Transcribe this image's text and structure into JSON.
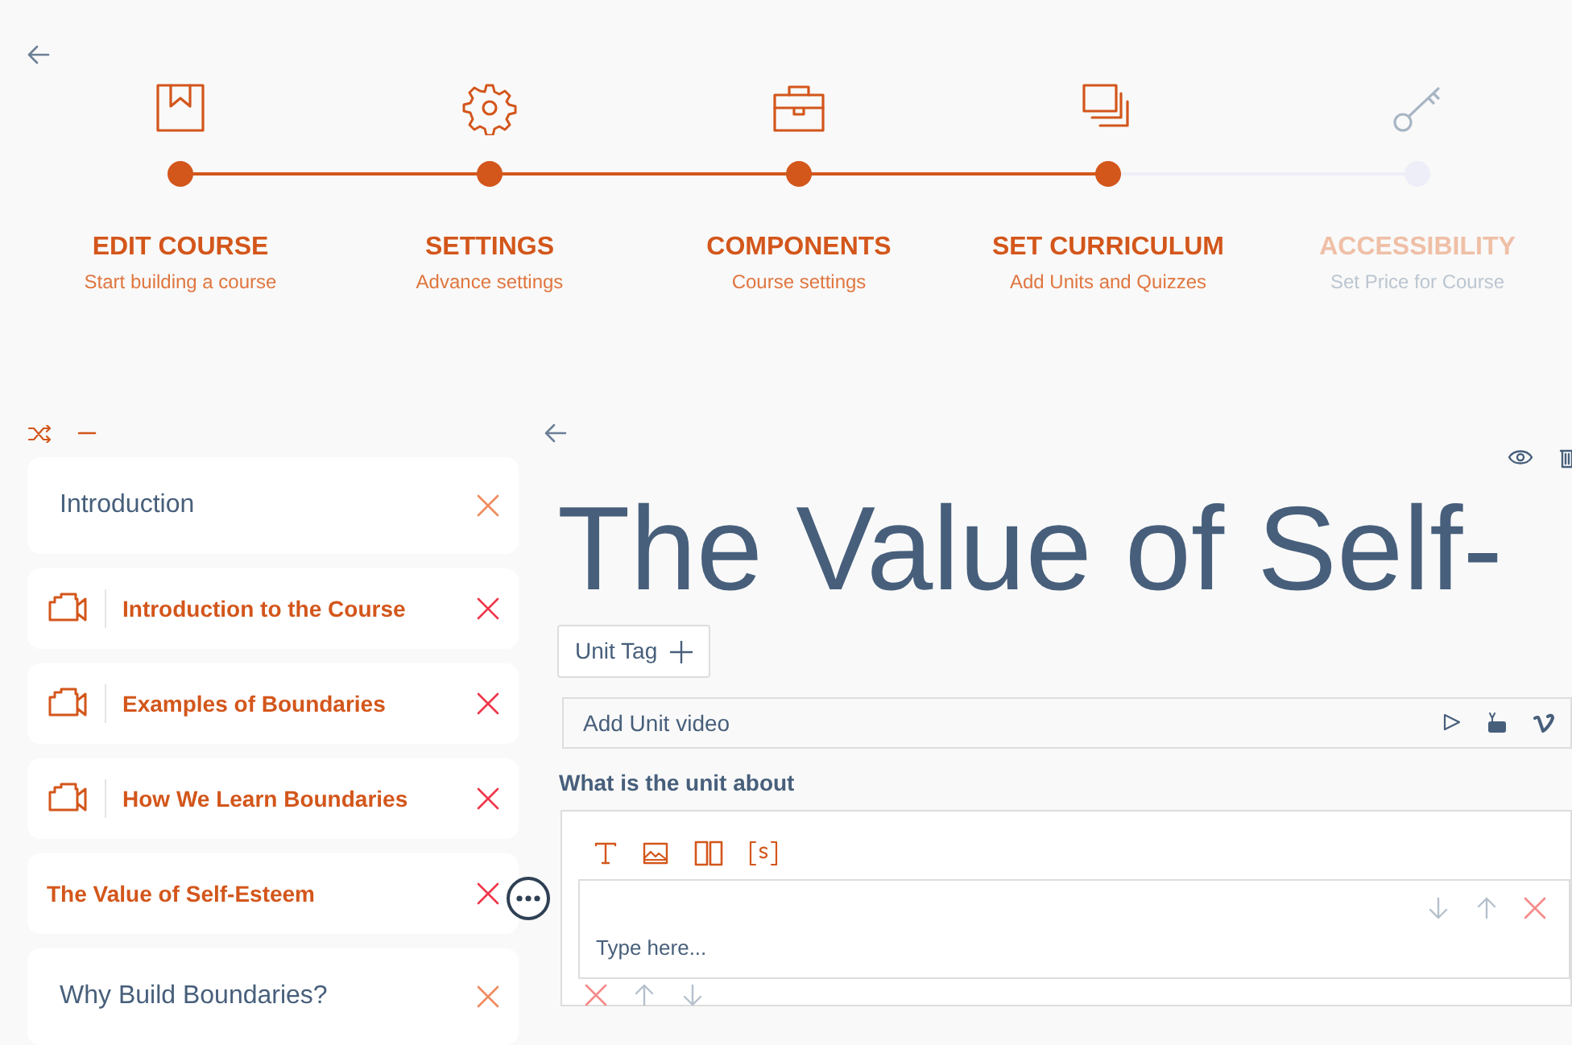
{
  "steps": [
    {
      "title": "EDIT COURSE",
      "subtitle": "Start building a course",
      "done": true
    },
    {
      "title": "SETTINGS",
      "subtitle": "Advance settings",
      "done": true
    },
    {
      "title": "COMPONENTS",
      "subtitle": "Course settings",
      "done": true
    },
    {
      "title": "SET CURRICULUM",
      "subtitle": "Add Units and Quizzes",
      "done": true
    },
    {
      "title": "ACCESSIBILITY",
      "subtitle": "Set Price for Course",
      "done": false
    }
  ],
  "curriculum": [
    {
      "kind": "section",
      "title": "Introduction"
    },
    {
      "kind": "video",
      "title": "Introduction to the Course"
    },
    {
      "kind": "video",
      "title": "Examples of Boundaries"
    },
    {
      "kind": "video",
      "title": "How We Learn Boundaries"
    },
    {
      "kind": "unit",
      "title": "The Value of Self-Esteem"
    },
    {
      "kind": "section",
      "title": "Why Build Boundaries?"
    }
  ],
  "unit": {
    "title": "The Value of Self-",
    "tag_button": "Unit Tag",
    "video_field": {
      "placeholder": "Add Unit video"
    },
    "about_label": "What is the unit about",
    "editor": {
      "placeholder": "Type here..."
    }
  }
}
